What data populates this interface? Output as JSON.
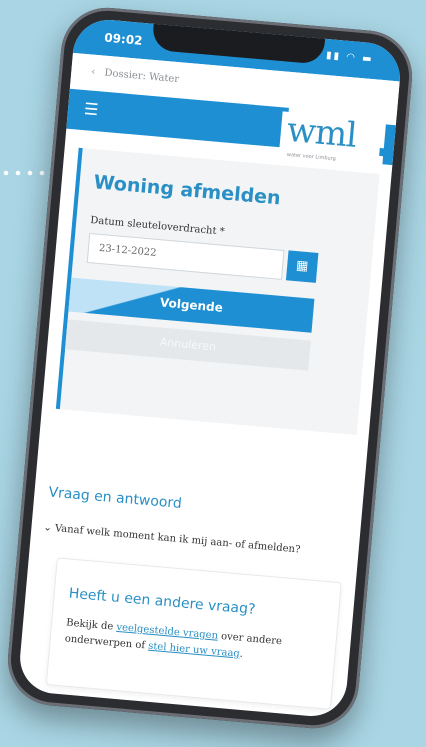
{
  "status": {
    "time": "09:02",
    "icons": "signal-icon wifi-icon battery-icon"
  },
  "breadcrumb": {
    "text": "Dossier: Water"
  },
  "header": {
    "logo": "wml",
    "logo_tagline": "water voor Limburg"
  },
  "form": {
    "title": "Woning afmelden",
    "date_label": "Datum sleuteloverdracht *",
    "date_value": "23-12-2022",
    "next_label": "Volgende",
    "cancel_label": "Annuleren"
  },
  "faq": {
    "title": "Vraag en antwoord",
    "items": [
      {
        "label": "Vanaf welk moment kan ik mij aan- of afmelden?"
      }
    ]
  },
  "question": {
    "title": "Heeft u een andere vraag?",
    "prefix": "Bekijk de ",
    "link1": "veelgestelde vragen",
    "middle": " over andere onderwerpen of ",
    "link2": "stel hier uw vraag",
    "suffix": "."
  }
}
